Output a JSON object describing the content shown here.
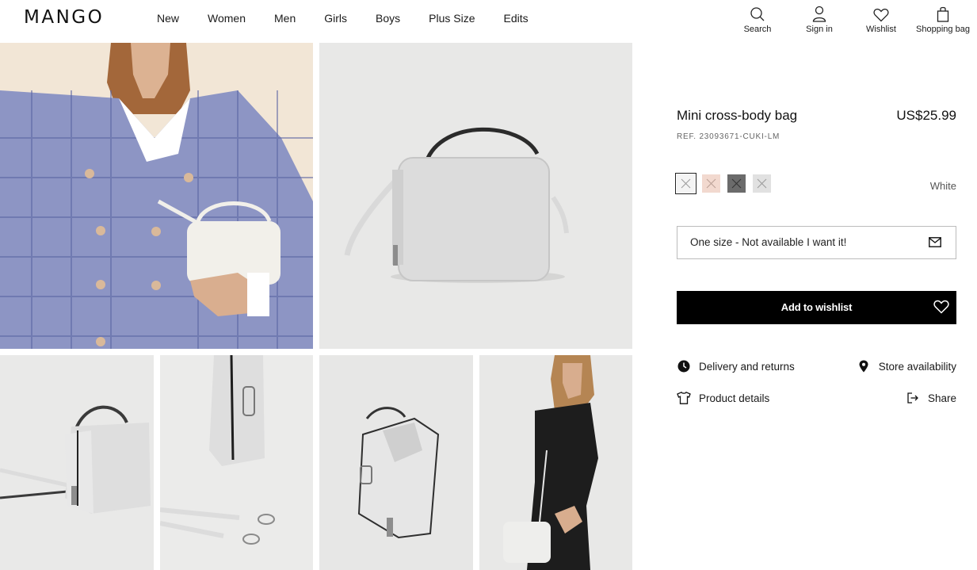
{
  "header": {
    "logo": "MANGO",
    "nav": [
      "New",
      "Women",
      "Men",
      "Girls",
      "Boys",
      "Plus Size",
      "Edits"
    ],
    "actions": [
      {
        "label": "Search",
        "icon": "search-icon"
      },
      {
        "label": "Sign in",
        "icon": "user-icon"
      },
      {
        "label": "Wishlist",
        "icon": "heart-icon"
      },
      {
        "label": "Shopping bag",
        "icon": "bag-icon"
      }
    ]
  },
  "gallery": {
    "images": [
      "model-wearing-bag-photo",
      "bag-front-photo",
      "bag-side-photo",
      "bag-strap-detail-photo",
      "bag-open-photo",
      "model-full-photo"
    ]
  },
  "product": {
    "title": "Mini cross-body bag",
    "price": "US$25.99",
    "ref": "REF. 23093671-CUKI-LM",
    "swatches": [
      {
        "name": "White",
        "color": "#f4f4f4",
        "selected": true
      },
      {
        "name": "Pink",
        "color": "#f2d9cf",
        "selected": false
      },
      {
        "name": "Dark grey",
        "color": "#6b6b6b",
        "selected": false
      },
      {
        "name": "Light grey",
        "color": "#e1e1e1",
        "selected": false
      }
    ],
    "selected_color": "White",
    "size_text": "One size - Not available I want it!",
    "wishlist_button": "Add to wishlist",
    "links": {
      "delivery": "Delivery and returns",
      "store": "Store availability",
      "details": "Product details",
      "share": "Share"
    }
  }
}
